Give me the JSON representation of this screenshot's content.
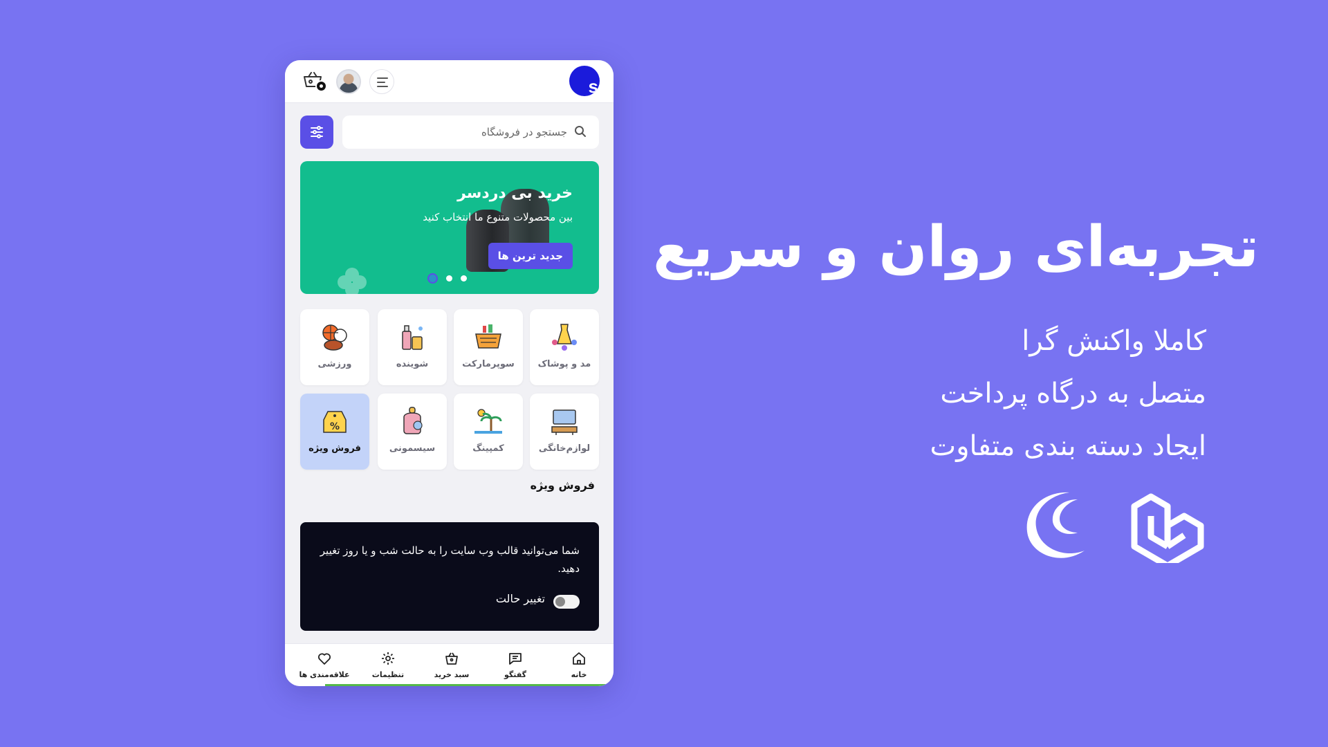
{
  "header": {
    "logo_letter": "s"
  },
  "search": {
    "placeholder": "جستجو در فروشگاه"
  },
  "banner": {
    "title": "خرید بی دردسر",
    "subtitle": "بین محصولات متنوع ما انتخاب کنید",
    "button_label": "جدید ترین ها",
    "slide_count": 3,
    "active_slide": 1
  },
  "categories": [
    {
      "label": "مد و پوشاک",
      "icon": "dress-icon"
    },
    {
      "label": "سوپرمارکت",
      "icon": "grocery-basket-icon"
    },
    {
      "label": "شوینده",
      "icon": "detergent-icon"
    },
    {
      "label": "ورزشی",
      "icon": "sports-balls-icon"
    },
    {
      "label": "لوازم‌خانگی",
      "icon": "tv-cabinet-icon"
    },
    {
      "label": "کمپینگ",
      "icon": "camping-icon"
    },
    {
      "label": "سیسمونی",
      "icon": "baby-bottle-icon"
    },
    {
      "label": "فروش ویژه",
      "icon": "discount-tag-icon"
    }
  ],
  "special_section": {
    "title": "فروش ویژه"
  },
  "dark_mode": {
    "text": "شما می‌توانید قالب وب سایت را به حالت شب و یا روز تغییر دهید.",
    "toggle_label": "تغییر حالت"
  },
  "bottom_nav": [
    {
      "label": "خانه",
      "icon": "home-icon"
    },
    {
      "label": "گفتگو",
      "icon": "chat-icon"
    },
    {
      "label": "سبد خرید",
      "icon": "basket-icon"
    },
    {
      "label": "تنظیمات",
      "icon": "gear-icon"
    },
    {
      "label": "علاقه‌مندی ها",
      "icon": "heart-icon"
    }
  ],
  "marketing": {
    "headline": "تجربه‌ای روان و سریع",
    "features": [
      "کاملا واکنش گرا",
      "متصل به درگاه پرداخت",
      "ایجاد دسته بندی متفاوت"
    ]
  },
  "colors": {
    "background": "#7873f2",
    "accent": "#5a4fe6",
    "banner": "#12bd8e",
    "dark_card": "#0a0b1a"
  }
}
